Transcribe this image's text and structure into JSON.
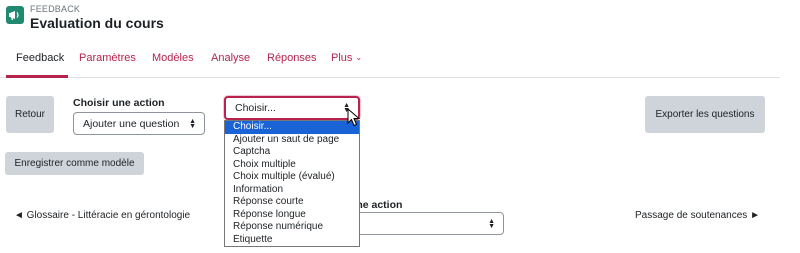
{
  "header": {
    "kicker": "FEEDBACK",
    "title": "Evaluation du cours",
    "icon": "feedback-megaphone-icon"
  },
  "nav": {
    "tabs": [
      {
        "label": "Feedback",
        "active": true
      },
      {
        "label": "Paramètres"
      },
      {
        "label": "Modèles"
      },
      {
        "label": "Analyse"
      },
      {
        "label": "Réponses"
      },
      {
        "label": "Plus"
      }
    ],
    "more_icon": "chevron-down-icon"
  },
  "toolbar": {
    "back_label": "Retour",
    "action_label": "Choisir une action",
    "action_select_value": "Ajouter une question",
    "choose_select_value": "Choisir...",
    "export_label": "Exporter les questions",
    "save_template_label": "Enregistrer comme modèle"
  },
  "dropdown": {
    "options": [
      "Choisir...",
      "Ajouter un saut de page",
      "Captcha",
      "Choix multiple",
      "Choix multiple (évalué)",
      "Information",
      "Réponse courte",
      "Réponse longue",
      "Réponse numérique",
      "Étiquette"
    ],
    "selected_index": 0
  },
  "footer": {
    "prev_link": "◄ Glossaire - Littéracie en gérontologie",
    "jump_label_partial": "ir une action",
    "next_link": "Passage de soutenances ►"
  },
  "colors": {
    "accent": "#b8234d",
    "button_bg": "#ced4da",
    "selected_option": "#1a63d6",
    "icon_bg": "#1f8a70"
  }
}
